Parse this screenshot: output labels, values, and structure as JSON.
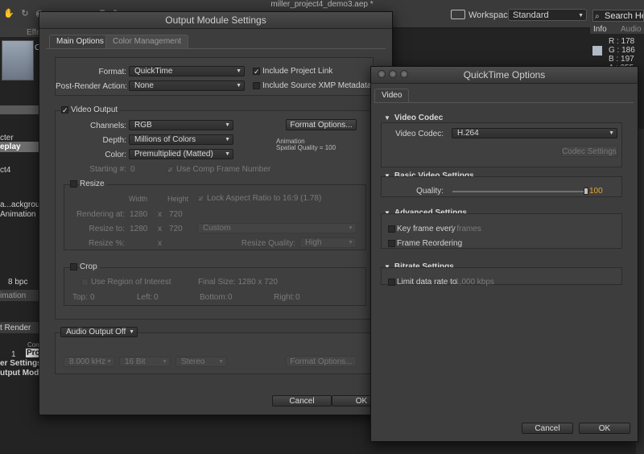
{
  "app": {
    "document_title": "miller_project4_demo3.aep *",
    "workspace_label": "Workspace:",
    "workspace_value": "Standard",
    "search_label": "Search Help",
    "info_tab": "Info",
    "audio_tab": "Audio",
    "color_info": [
      "R : 178",
      "G : 186",
      "B : 197",
      "A : 255"
    ]
  },
  "background": {
    "project_label_1": "Effe",
    "project_label_c": "C",
    "items": [
      "cter",
      "eplay",
      "ct4",
      "a...ackground",
      "Animation"
    ],
    "bpc": "8 bpc",
    "animation_tab": "imation",
    "render_header": "t Render",
    "render_col": "Com",
    "render_row_num": "1",
    "render_row_name": "Pro",
    "render_settings": "er Settings:",
    "output_module": "utput Module:"
  },
  "output_module": {
    "title": "Output Module Settings",
    "tabs": [
      "Main Options",
      "Color Management"
    ],
    "format_label": "Format:",
    "format_value": "QuickTime",
    "post_render_label": "Post-Render Action:",
    "post_render_value": "None",
    "include_project_link": "Include Project Link",
    "include_xmp": "Include Source XMP Metadata",
    "video_output": "Video Output",
    "channels_label": "Channels:",
    "channels_value": "RGB",
    "depth_label": "Depth:",
    "depth_value": "Millions of Colors",
    "color_label": "Color:",
    "color_value": "Premultiplied (Matted)",
    "format_options": "Format Options...",
    "codec_info_1": "Animation",
    "codec_info_2": "Spatial Quality = 100",
    "starting_label": "Starting #:",
    "starting_value": "0",
    "use_comp_frame": "Use Comp Frame Number",
    "resize": "Resize",
    "width_hdr": "Width",
    "height_hdr": "Height",
    "lock_aspect": "Lock Aspect Ratio to 16:9 (1.78)",
    "rendering_at_label": "Rendering at:",
    "rendering_w": "1280",
    "rendering_h": "720",
    "resize_to_label": "Resize to:",
    "resize_w": "1280",
    "resize_h": "720",
    "resize_preset": "Custom",
    "resize_pct_label": "Resize %:",
    "times": "x",
    "resize_quality_label": "Resize Quality:",
    "resize_quality_value": "High",
    "crop": "Crop",
    "use_roi": "Use Region of Interest",
    "final_size": "Final Size: 1280 x 720",
    "top_label": "Top:",
    "top_value": "0",
    "left_label": "Left:",
    "left_value": "0",
    "bottom_label": "Bottom:",
    "bottom_value": "0",
    "right_label": "Right:",
    "right_value": "0",
    "audio_output": "Audio Output Off",
    "sample_rate": "8.000 kHz",
    "bit_depth": "16 Bit",
    "channels_audio": "Stereo",
    "audio_format_options": "Format Options...",
    "cancel": "Cancel",
    "ok": "OK"
  },
  "quicktime": {
    "title": "QuickTime Options",
    "tab": "Video",
    "video_codec_section": "Video Codec",
    "video_codec_label": "Video Codec:",
    "video_codec_value": "H.264",
    "codec_settings": "Codec Settings",
    "basic_section": "Basic Video Settings",
    "quality_label": "Quality:",
    "quality_value": "100",
    "quality_level": 1.0,
    "advanced_section": "Advanced Settings",
    "key_frame_label": "Key frame every",
    "key_frame_value": "1 frames",
    "frame_reordering": "Frame Reordering",
    "bitrate_section": "Bitrate Settings",
    "limit_rate_label": "Limit data rate to",
    "limit_rate_value": "1,000 kbps",
    "cancel": "Cancel",
    "ok": "OK"
  },
  "colors": {
    "accent_quality": "#e6a42a",
    "dialog_bg": "#3d3d3d",
    "app_bg": "#232323"
  }
}
